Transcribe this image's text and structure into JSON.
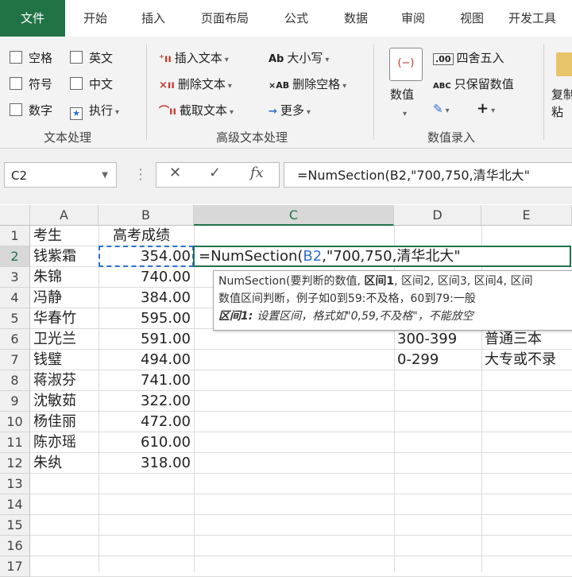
{
  "tabs": [
    "文件",
    "开始",
    "插入",
    "页面布局",
    "公式",
    "数据",
    "审阅",
    "视图",
    "开发工具"
  ],
  "ribbon": {
    "text_group": {
      "items": [
        "空格",
        "英文",
        "符号",
        "中文",
        "数字",
        "执行"
      ],
      "label": "文本处理"
    },
    "advanced_group": {
      "items": [
        "插入文本",
        "大小写",
        "删除文本",
        "删除空格",
        "截取文本",
        "更多"
      ],
      "label": "高级文本处理"
    },
    "number_group": {
      "big_button": "数值",
      "items": [
        "四舍五入",
        "只保留数值"
      ],
      "label": "数值录入"
    },
    "copy_partial": "复制\n粘"
  },
  "name_box": "C2",
  "formula": "=NumSection(B2,\"700,750,清华北大\"",
  "columns": [
    "A",
    "B",
    "C",
    "D",
    "E"
  ],
  "rows": [
    "1",
    "2",
    "3",
    "4",
    "5",
    "6",
    "7",
    "8",
    "9",
    "10",
    "11",
    "12",
    "13",
    "14",
    "15",
    "16",
    "17"
  ],
  "cells": {
    "A1": "考生",
    "B1": "高考成绩",
    "A2": "钱紫霜",
    "B2": "354.00",
    "A3": "朱锦",
    "B3": "740.00",
    "A4": "冯静",
    "B4": "384.00",
    "A5": "华春竹",
    "B5": "595.00",
    "A6": "卫光兰",
    "B6": "591.00",
    "A7": "钱璧",
    "B7": "494.00",
    "A8": "蒋淑芬",
    "B8": "741.00",
    "A9": "沈敏茹",
    "B9": "322.00",
    "A10": "杨佳丽",
    "B10": "472.00",
    "A11": "陈亦瑶",
    "B11": "610.00",
    "A12": "朱纨",
    "B12": "318.00",
    "D6": "300-399",
    "E6": "普通三本",
    "D7": "0-299",
    "E7": "大专或不录"
  },
  "edit_cell": {
    "prefix": "=NumSection(",
    "ref": "B2",
    "rest": ",\"700,750,清华北大\""
  },
  "tooltip": {
    "line1_a": "NumSection(要判断的数值, ",
    "line1_b": "区间1",
    "line1_c": ", 区间2, 区间3, 区间4, 区间",
    "line2": "数值区间判断，例子如0到59:不及格，60到79:一般",
    "line3_a": "区间1: ",
    "line3_b": "设置区间，格式如\"0,59,不及格\"，不能放空"
  },
  "colors": {
    "accent": "#217346",
    "ref_blue": "#2f6fd1"
  }
}
